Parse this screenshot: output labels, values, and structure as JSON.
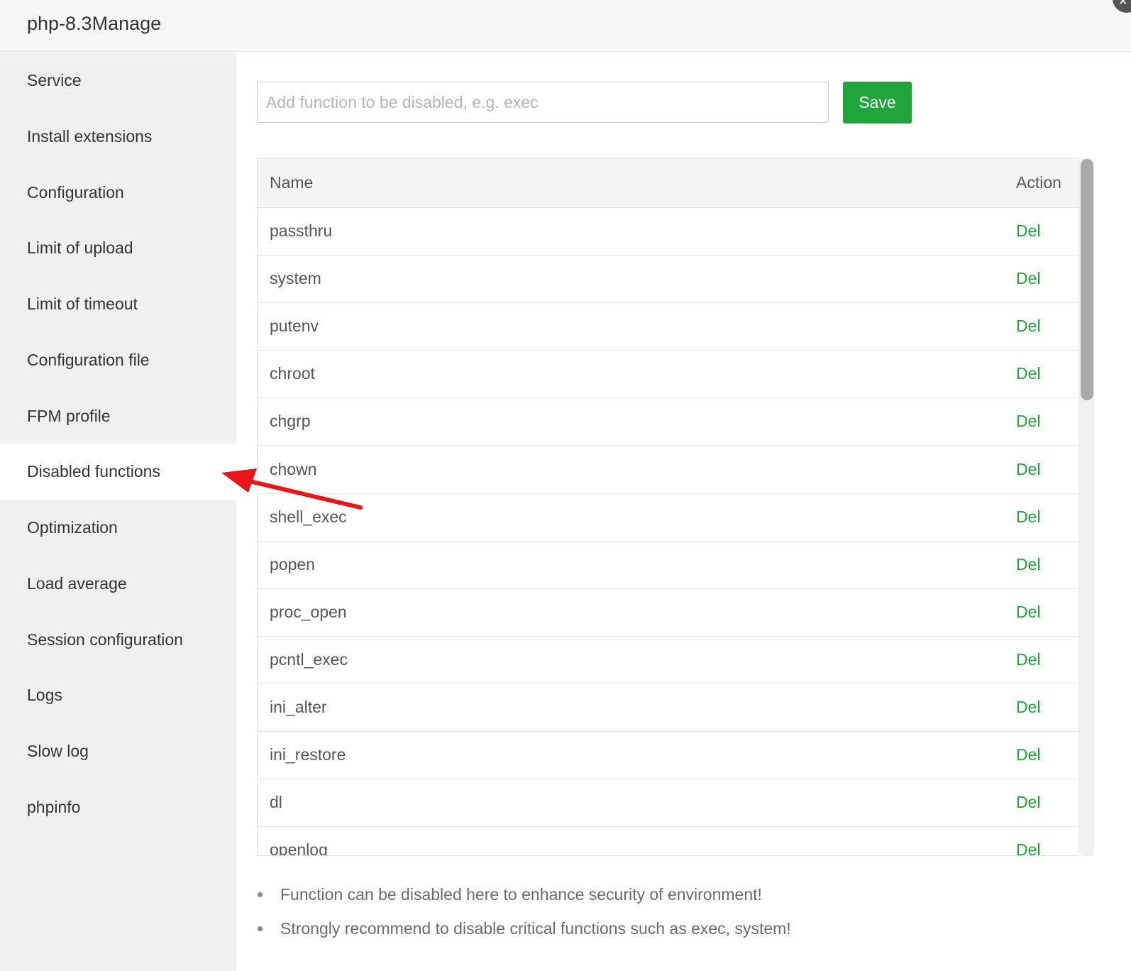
{
  "window": {
    "title": "php-8.3Manage"
  },
  "sidebar": {
    "items": [
      {
        "label": "Service"
      },
      {
        "label": "Install extensions"
      },
      {
        "label": "Configuration"
      },
      {
        "label": "Limit of upload"
      },
      {
        "label": "Limit of timeout"
      },
      {
        "label": "Configuration file"
      },
      {
        "label": "FPM profile"
      },
      {
        "label": "Disabled functions",
        "active": true
      },
      {
        "label": "Optimization"
      },
      {
        "label": "Load average"
      },
      {
        "label": "Session configuration"
      },
      {
        "label": "Logs"
      },
      {
        "label": "Slow log"
      },
      {
        "label": "phpinfo"
      }
    ]
  },
  "form": {
    "placeholder": "Add function to be disabled, e.g. exec",
    "save_label": "Save"
  },
  "table": {
    "headers": {
      "name": "Name",
      "action": "Action"
    },
    "rows": [
      {
        "name": "passthru",
        "action": "Del"
      },
      {
        "name": "system",
        "action": "Del"
      },
      {
        "name": "putenv",
        "action": "Del"
      },
      {
        "name": "chroot",
        "action": "Del"
      },
      {
        "name": "chgrp",
        "action": "Del"
      },
      {
        "name": "chown",
        "action": "Del"
      },
      {
        "name": "shell_exec",
        "action": "Del"
      },
      {
        "name": "popen",
        "action": "Del"
      },
      {
        "name": "proc_open",
        "action": "Del"
      },
      {
        "name": "pcntl_exec",
        "action": "Del"
      },
      {
        "name": "ini_alter",
        "action": "Del"
      },
      {
        "name": "ini_restore",
        "action": "Del"
      },
      {
        "name": "dl",
        "action": "Del"
      },
      {
        "name": "openlog",
        "action": "Del"
      }
    ]
  },
  "notes": [
    "Function can be disabled here to enhance security of environment!",
    "Strongly recommend to disable critical functions such as exec, system!"
  ],
  "icons": {
    "close": "close-icon",
    "annotation": "red-arrow-annotation"
  },
  "colors": {
    "accent_green": "#20a53a",
    "annotation_red": "#e8151a",
    "sidebar_bg": "#f0f0f0"
  }
}
